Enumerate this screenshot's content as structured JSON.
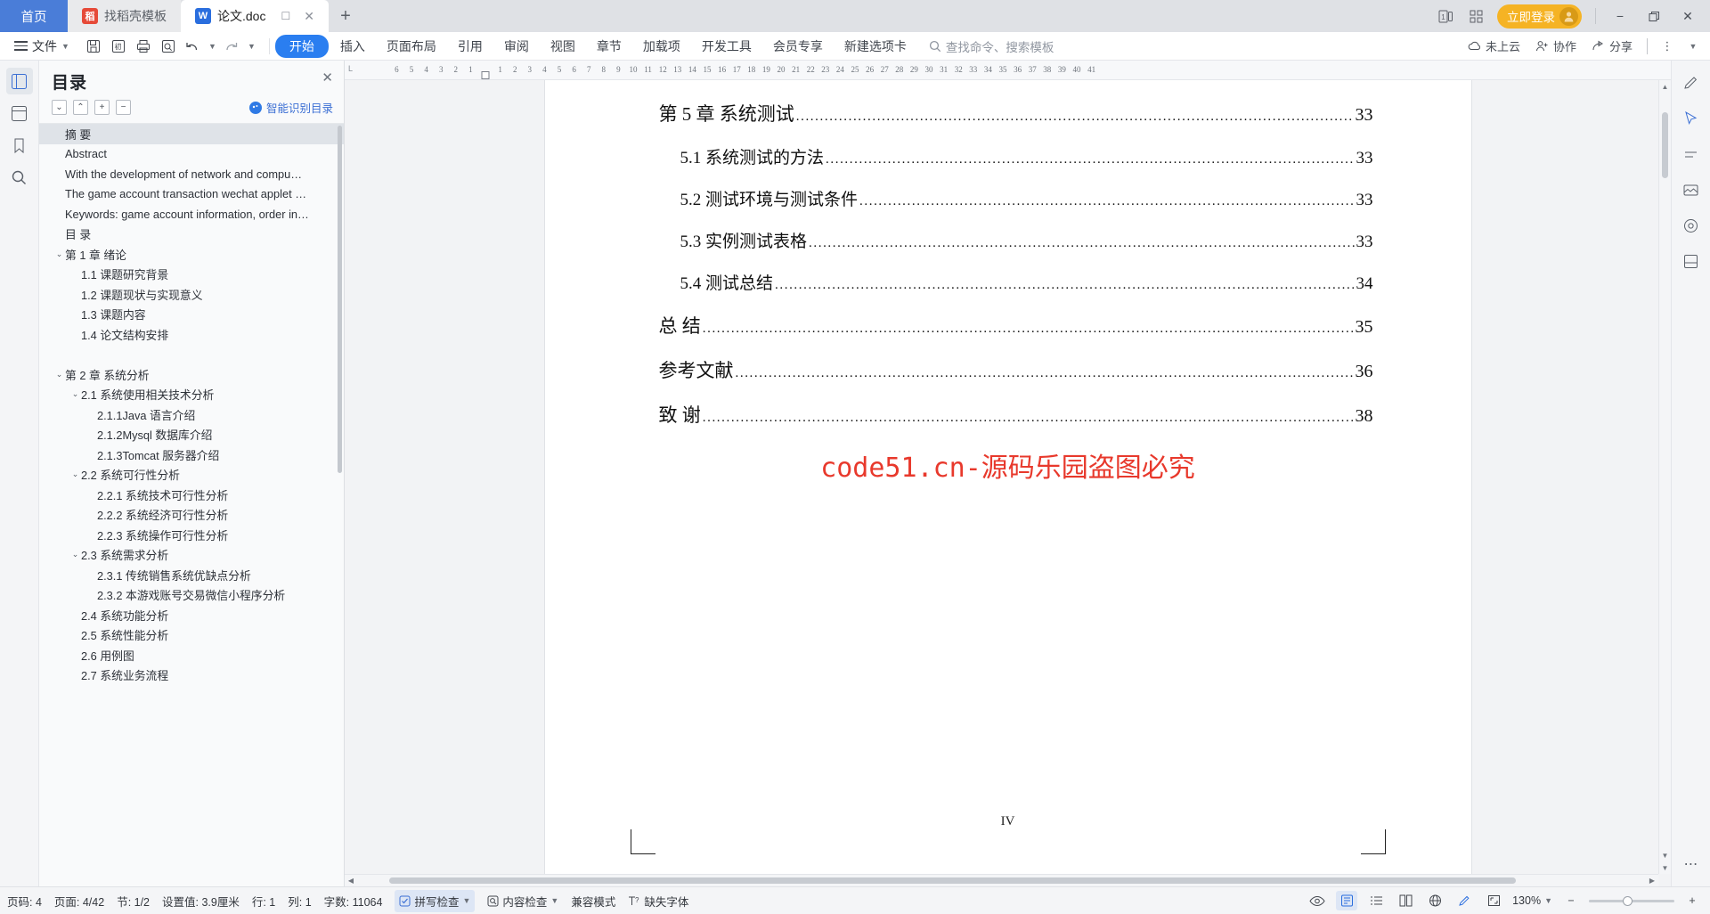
{
  "window": {
    "tabs": [
      {
        "label": "首页",
        "type": "home",
        "icon": "home-tab"
      },
      {
        "label": "找稻壳模板",
        "type": "inactive",
        "icon": "docer-icon"
      },
      {
        "label": "论文.doc",
        "type": "active",
        "icon": "wps-writer-icon"
      }
    ],
    "new_tab_label": "+",
    "login_label": "立即登录",
    "minimize": "−",
    "restore": "❐",
    "close": "✕"
  },
  "ribbon": {
    "file_label": "文件",
    "tabs": [
      {
        "label": "开始",
        "selected": true
      },
      {
        "label": "插入",
        "selected": false
      },
      {
        "label": "页面布局",
        "selected": false
      },
      {
        "label": "引用",
        "selected": false
      },
      {
        "label": "审阅",
        "selected": false
      },
      {
        "label": "视图",
        "selected": false
      },
      {
        "label": "章节",
        "selected": false
      },
      {
        "label": "加载项",
        "selected": false
      },
      {
        "label": "开发工具",
        "selected": false
      },
      {
        "label": "会员专享",
        "selected": false
      },
      {
        "label": "新建选项卡",
        "selected": false
      }
    ],
    "search_placeholder": "查找命令、搜索模板",
    "right_items": [
      {
        "label": "未上云",
        "icon": "cloud-icon"
      },
      {
        "label": "协作",
        "icon": "collaborate-icon"
      },
      {
        "label": "分享",
        "icon": "share-icon"
      }
    ]
  },
  "outline": {
    "title": "目录",
    "close_label": "✕",
    "tools": [
      "⌄",
      "⌃",
      "+",
      "−"
    ],
    "smart_label": "智能识别目录",
    "items": [
      {
        "label": "摘  要",
        "indent": 0,
        "chevron": "",
        "selected": true
      },
      {
        "label": "Abstract",
        "indent": 0,
        "chevron": "",
        "selected": false
      },
      {
        "label": "With the development of network and compu…",
        "indent": 0,
        "chevron": "",
        "selected": false
      },
      {
        "label": "The game account transaction wechat applet …",
        "indent": 0,
        "chevron": "",
        "selected": false
      },
      {
        "label": "Keywords: game account information, order in…",
        "indent": 0,
        "chevron": "",
        "selected": false
      },
      {
        "label": "目 录",
        "indent": 0,
        "chevron": "",
        "selected": false
      },
      {
        "label": "第 1 章   绪论",
        "indent": 0,
        "chevron": "⌄",
        "selected": false
      },
      {
        "label": "1.1 课题研究背景",
        "indent": 1,
        "chevron": "",
        "selected": false
      },
      {
        "label": "1.2 课题现状与实现意义",
        "indent": 1,
        "chevron": "",
        "selected": false
      },
      {
        "label": "1.3 课题内容",
        "indent": 1,
        "chevron": "",
        "selected": false
      },
      {
        "label": "1.4 论文结构安排",
        "indent": 1,
        "chevron": "",
        "selected": false
      },
      {
        "label": "",
        "indent": 0,
        "chevron": "",
        "selected": false
      },
      {
        "label": "第 2 章   系统分析",
        "indent": 0,
        "chevron": "⌄",
        "selected": false
      },
      {
        "label": "2.1 系统使用相关技术分析",
        "indent": 1,
        "chevron": "⌄",
        "selected": false
      },
      {
        "label": "2.1.1Java 语言介绍",
        "indent": 2,
        "chevron": "",
        "selected": false
      },
      {
        "label": "2.1.2Mysql 数据库介绍",
        "indent": 2,
        "chevron": "",
        "selected": false
      },
      {
        "label": "2.1.3Tomcat 服务器介绍",
        "indent": 2,
        "chevron": "",
        "selected": false
      },
      {
        "label": "2.2 系统可行性分析",
        "indent": 1,
        "chevron": "⌄",
        "selected": false
      },
      {
        "label": "2.2.1 系统技术可行性分析",
        "indent": 2,
        "chevron": "",
        "selected": false
      },
      {
        "label": "2.2.2 系统经济可行性分析",
        "indent": 2,
        "chevron": "",
        "selected": false
      },
      {
        "label": "2.2.3 系统操作可行性分析",
        "indent": 2,
        "chevron": "",
        "selected": false
      },
      {
        "label": "2.3 系统需求分析",
        "indent": 1,
        "chevron": "⌄",
        "selected": false
      },
      {
        "label": "2.3.1 传统销售系统优缺点分析",
        "indent": 2,
        "chevron": "",
        "selected": false
      },
      {
        "label": "2.3.2 本游戏账号交易微信小程序分析",
        "indent": 2,
        "chevron": "",
        "selected": false
      },
      {
        "label": "2.4 系统功能分析",
        "indent": 1,
        "chevron": "",
        "selected": false
      },
      {
        "label": "2.5 系统性能分析",
        "indent": 1,
        "chevron": "",
        "selected": false
      },
      {
        "label": "2.6 用例图",
        "indent": 1,
        "chevron": "",
        "selected": false
      },
      {
        "label": "2.7 系统业务流程",
        "indent": 1,
        "chevron": "",
        "selected": false
      }
    ]
  },
  "ruler": {
    "left_marks": [
      6,
      5,
      4,
      3,
      2,
      1
    ],
    "right_marks": [
      1,
      2,
      3,
      4,
      5,
      6,
      7,
      8,
      9,
      10,
      11,
      12,
      13,
      14,
      15,
      16,
      17,
      18,
      19,
      20,
      21,
      22,
      23,
      24,
      25,
      26,
      27,
      28,
      29,
      30,
      31,
      32,
      33,
      34,
      35,
      36,
      37,
      38,
      39,
      40,
      41
    ],
    "corner_label": "L"
  },
  "document": {
    "toc_entries": [
      {
        "text": "第 5 章  系统测试",
        "page": "33",
        "level": 1
      },
      {
        "text": "5.1 系统测试的方法",
        "page": "33",
        "level": 2
      },
      {
        "text": "5.2 测试环境与测试条件",
        "page": "33",
        "level": 2
      },
      {
        "text": "5.3 实例测试表格",
        "page": "33",
        "level": 2
      },
      {
        "text": "5.4 测试总结",
        "page": "34",
        "level": 2
      },
      {
        "text": "总  结",
        "page": "35",
        "level": 1
      },
      {
        "text": "参考文献",
        "page": "36",
        "level": 1
      },
      {
        "text": "致    谢",
        "page": "38",
        "level": 1
      }
    ],
    "watermark": "code51.cn-源码乐园盗图必究",
    "page_footer": "IV"
  },
  "status": {
    "page_num": "页码: 4",
    "pages": "页面: 4/42",
    "section": "节: 1/2",
    "setting": "设置值: 3.9厘米",
    "row": "行: 1",
    "col": "列: 1",
    "words": "字数: 11064",
    "spellcheck": "拼写检查",
    "contentcheck": "内容检查",
    "compat": "兼容模式",
    "missing_font": "缺失字体",
    "zoom": "130%",
    "zoom_out": "−",
    "zoom_in": "+"
  },
  "colors": {
    "accent": "#2a7ef0",
    "home_tab": "#4a7dd8",
    "login": "#f5b324",
    "watermark": "#e8392c",
    "docer": "#e64a38",
    "wps": "#2a6ede"
  }
}
